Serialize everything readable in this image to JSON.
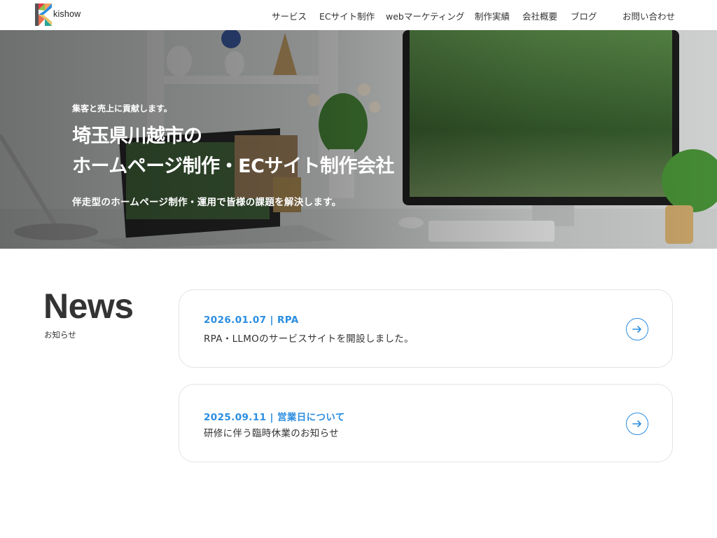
{
  "brand": {
    "name": "kishow"
  },
  "nav": [
    {
      "label": "サービス"
    },
    {
      "label": "ECサイト制作"
    },
    {
      "label": "webマーケティング"
    },
    {
      "label": "制作実績"
    },
    {
      "label": "会社概要"
    },
    {
      "label": "ブログ"
    },
    {
      "label": "お問い合わせ"
    }
  ],
  "hero": {
    "kicker": "集客と売上に貢献します。",
    "title_line1": "埼玉県川越市の",
    "title_line2": "ホームページ制作・ECサイト制作会社",
    "subtitle": "伴走型のホームページ制作・運用で皆様の課題を解決します。"
  },
  "news": {
    "heading": "News",
    "subheading": "お知らせ",
    "items": [
      {
        "date": "2026.01.07",
        "category": "RPA",
        "title": "RPA・LLMOのサービスサイトを開設しました。"
      },
      {
        "date": "2025.09.11",
        "category": "営業日について",
        "title": "研修に伴う臨時休業のお知らせ"
      }
    ]
  },
  "colors": {
    "accent": "#2a8de0",
    "text": "#333333",
    "card_border": "#e3e3e3"
  },
  "icons": {
    "card_action": "arrow-right-icon"
  }
}
